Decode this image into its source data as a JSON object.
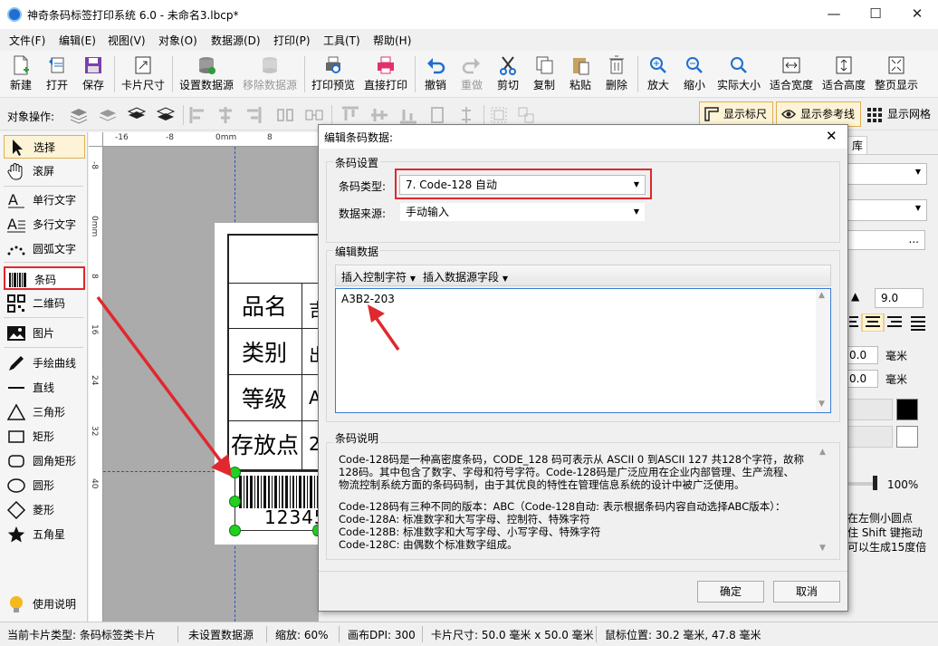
{
  "window": {
    "title": "神奇条码标签打印系统 6.0 - 未命名3.lbcp*"
  },
  "menu": [
    "文件(F)",
    "编辑(E)",
    "视图(V)",
    "对象(O)",
    "数据源(D)",
    "打印(P)",
    "工具(T)",
    "帮助(H)"
  ],
  "toolbar": {
    "new": "新建",
    "open": "打开",
    "save": "保存",
    "card_size": "卡片尺寸",
    "set_datasource": "设置数据源",
    "remove_datasource": "移除数据源",
    "print_preview": "打印预览",
    "direct_print": "直接打印",
    "undo": "撤销",
    "redo": "重做",
    "cut": "剪切",
    "copy": "复制",
    "paste": "粘贴",
    "delete": "删除",
    "zoom_in": "放大",
    "zoom_out": "缩小",
    "actual_size": "实际大小",
    "fit_width": "适合宽度",
    "fit_height": "适合高度",
    "full_page": "整页显示"
  },
  "objbar": {
    "label": "对象操作:",
    "show_ruler": "显示标尺",
    "show_guides": "显示参考线",
    "show_grid": "显示网格"
  },
  "tools": {
    "select": "选择",
    "scroll": "滚屏",
    "single_text": "单行文字",
    "multi_text": "多行文字",
    "arc_text": "圆弧文字",
    "barcode": "条码",
    "qrcode": "二维码",
    "image": "图片",
    "freehand": "手绘曲线",
    "line": "直线",
    "triangle": "三角形",
    "rect": "矩形",
    "round_rect": "圆角矩形",
    "circle": "圆形",
    "diamond": "菱形",
    "star": "五角星",
    "help": "使用说明"
  },
  "ruler": {
    "h": [
      "-16",
      "-8",
      "0mm",
      "8"
    ],
    "v": [
      "-8",
      "0mm",
      "8",
      "16",
      "24",
      "32",
      "40"
    ]
  },
  "label": {
    "rows": [
      "品名",
      "类别",
      "等级",
      "存放点"
    ],
    "partial": [
      "吉",
      "出",
      "A",
      "2"
    ],
    "barcode_text": "12345"
  },
  "right_panel": {
    "tab": "库",
    "font_size": "9.0",
    "spin1": "0.0",
    "spin2": "0.0",
    "unit": "毫米",
    "opacity": "100%",
    "hint": [
      "在左侧小圆点",
      "住 Shift 键拖动",
      "可以生成15度倍"
    ],
    "ellipsis": "..."
  },
  "status": {
    "card_type": "当前卡片类型: 条码标签类卡片",
    "datasource": "未设置数据源",
    "zoom": "缩放: 60%",
    "dpi": "画布DPI: 300",
    "card_size": "卡片尺寸: 50.0 毫米 x 50.0 毫米",
    "mouse_pos": "鼠标位置: 30.2 毫米, 47.8 毫米"
  },
  "dialog": {
    "title": "编辑条码数据:",
    "group_settings": "条码设置",
    "barcode_type_label": "条码类型:",
    "barcode_type_value": "7.  Code-128 自动",
    "datasource_label": "数据来源:",
    "datasource_value": "手动输入",
    "group_edit": "编辑数据",
    "insert_control": "插入控制字符",
    "insert_field": "插入数据源字段",
    "data_value": "A3B2-203",
    "group_desc": "条码说明",
    "desc_lines": [
      "Code-128码是一种高密度条码，CODE_128 码可表示从 ASCII 0 到ASCII 127 共128个字符，故称",
      "128码。其中包含了数字、字母和符号字符。Code-128码是广泛应用在企业内部管理、生产流程、",
      "物流控制系统方面的条码码制，由于其优良的特性在管理信息系统的设计中被广泛使用。",
      "",
      "Code-128码有三种不同的版本：ABC（Code-128自动: 表示根据条码内容自动选择ABC版本）：",
      "Code-128A: 标准数字和大写字母、控制符、特殊字符",
      "Code-128B: 标准数字和大写字母、小写字母、特殊字符",
      "Code-128C: 由偶数个标准数字组成。"
    ],
    "ok": "确定",
    "cancel": "取消"
  },
  "colors": {
    "highlight": "#e0282e",
    "accent": "#1e6fd0",
    "canvas": "#ababab"
  }
}
